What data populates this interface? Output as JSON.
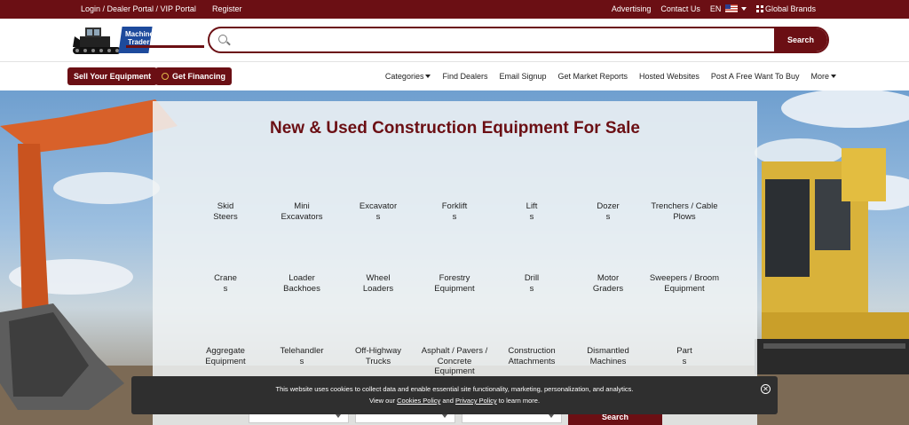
{
  "topbar": {
    "left_links": "Login / Dealer Portal / VIP Portal",
    "register": "Register",
    "advertising": "Advertising",
    "contact": "Contact Us",
    "language": "EN",
    "global": "Global Brands"
  },
  "header": {
    "logo_text": "Machinery Trader",
    "search_placeholder": "",
    "search_button": "Search"
  },
  "nav": {
    "sell_button": "Sell Your Equipment",
    "financing_button": "Get Financing",
    "links": [
      "Categories",
      "Find Dealers",
      "Email Signup",
      "Get Market Reports",
      "Hosted Websites",
      "Post A Free Want To Buy",
      "More"
    ]
  },
  "hero": {
    "title": "New & Used Construction Equipment For Sale",
    "categories": [
      [
        "Skid",
        "Steers"
      ],
      [
        "Mini",
        "Excavators"
      ],
      [
        "Excavator",
        "s"
      ],
      [
        "Forklift",
        "s"
      ],
      [
        "Lift",
        "s"
      ],
      [
        "Dozer",
        "s"
      ],
      [
        "Trenchers / Cable",
        "Plows"
      ],
      [
        "Crane",
        "s"
      ],
      [
        "Loader",
        "Backhoes"
      ],
      [
        "Wheel",
        "Loaders"
      ],
      [
        "Forestry",
        "Equipment"
      ],
      [
        "Drill",
        "s"
      ],
      [
        "Motor",
        "Graders"
      ],
      [
        "Sweepers / Broom",
        "Equipment"
      ],
      [
        "Aggregate",
        "Equipment"
      ],
      [
        "Telehandler",
        "s"
      ],
      [
        "Off-Highway",
        "Trucks"
      ],
      [
        "Asphalt / Pavers /",
        "Concrete",
        "Equipment"
      ],
      [
        "Construction",
        "Attachments"
      ],
      [
        "Dismantled",
        "Machines"
      ],
      [
        "Part",
        "s"
      ]
    ],
    "search_button": "Search"
  },
  "cookie": {
    "line1": "This website uses cookies to collect data and enable essential site functionality, marketing, personalization, and analytics.",
    "line2_pre": "View our ",
    "cookies_policy": "Cookies Policy",
    "line2_mid": " and ",
    "privacy_policy": "Privacy Policy",
    "line2_post": " to learn more."
  },
  "colors": {
    "brand": "#6b0f14"
  }
}
